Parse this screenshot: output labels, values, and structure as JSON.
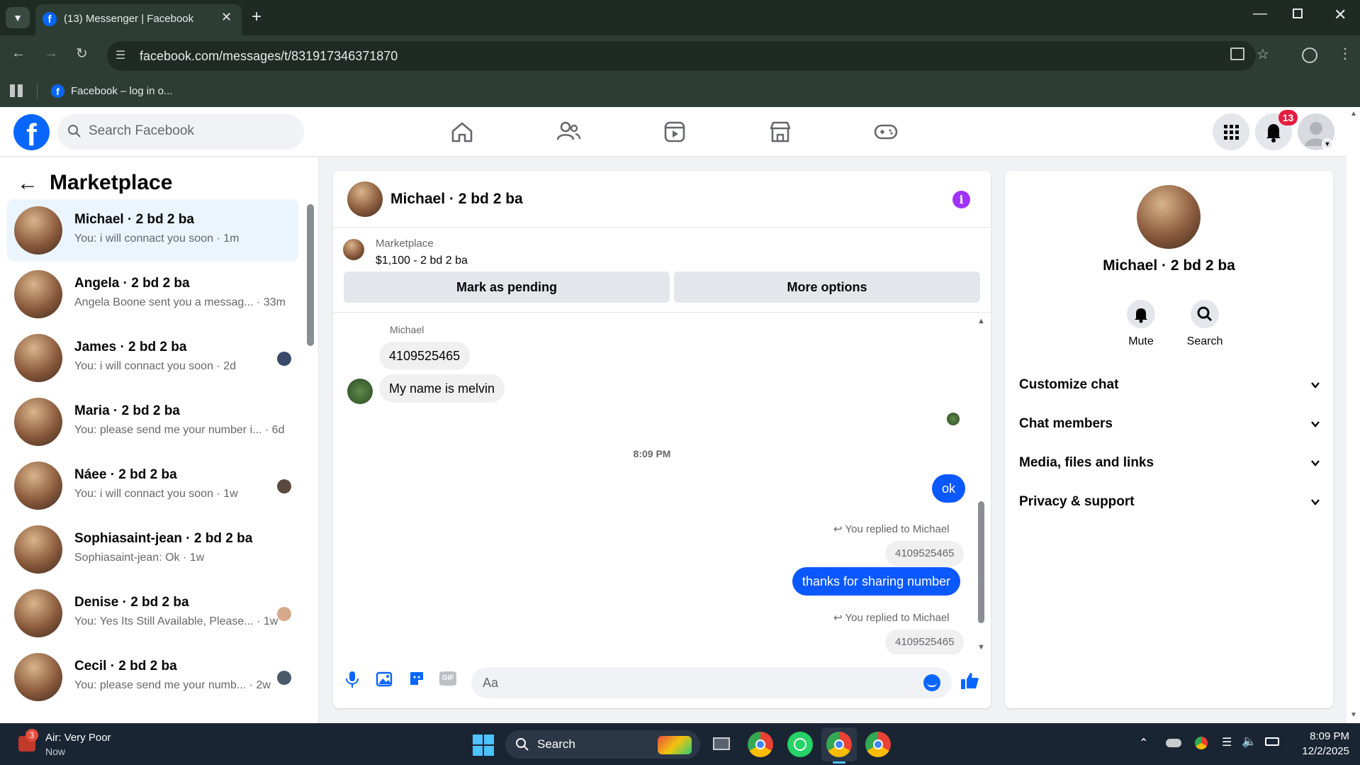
{
  "browser": {
    "tab_title": "(13) Messenger | Facebook",
    "url": "facebook.com/messages/t/831917346371870",
    "bookmark": "Facebook – log in o..."
  },
  "fb": {
    "search_placeholder": "Search Facebook",
    "notifications_count": "13",
    "brand_color": "#0866ff"
  },
  "sidebar": {
    "title": "Marketplace",
    "conversations": [
      {
        "title": "Michael · 2 bd 2 ba",
        "preview": "You: i will connact you soon · 1m"
      },
      {
        "title": "Angela · 2 bd 2 ba",
        "preview": "Angela Boone sent you a messag... · 33m"
      },
      {
        "title": "James · 2 bd 2 ba",
        "preview": "You: i will connact you soon · 2d"
      },
      {
        "title": "Maria · 2 bd 2 ba",
        "preview": "You: please send me your number i... · 6d"
      },
      {
        "title": "Náee · 2 bd 2 ba",
        "preview": "You: i will connact you soon · 1w"
      },
      {
        "title": "Sophiasaint-jean · 2 bd 2 ba",
        "preview": "Sophiasaint-jean: Ok · 1w"
      },
      {
        "title": "Denise · 2 bd 2 ba",
        "preview": "You: Yes Its Still Available, Please... · 1w"
      },
      {
        "title": "Cecil · 2 bd 2 ba",
        "preview": "You: please send me your numb... · 2w"
      }
    ]
  },
  "chat": {
    "title": "Michael · 2 bd 2 ba",
    "listing_label": "Marketplace",
    "listing_price": "$1,100 - 2 bd 2 ba",
    "mark_pending": "Mark as pending",
    "more_options": "More options",
    "sender_name": "Michael",
    "msg_number": "4109525465",
    "msg_name": "My name is melvin",
    "time_divider": "8:09 PM",
    "msg_ok": "ok",
    "reply_note": "You replied to Michael",
    "quoted_1": "4109525465",
    "msg_thanks": "thanks for sharing number",
    "quoted_2": "4109525465",
    "composer_placeholder": "Aa"
  },
  "details": {
    "name": "Michael · 2 bd 2 ba",
    "mute": "Mute",
    "search": "Search",
    "sections": [
      "Customize chat",
      "Chat members",
      "Media, files and links",
      "Privacy & support"
    ]
  },
  "taskbar": {
    "weather_title": "Air: Very Poor",
    "weather_sub": "Now",
    "weather_badge": "3",
    "search": "Search",
    "time": "8:09 PM",
    "date": "12/2/2025"
  }
}
